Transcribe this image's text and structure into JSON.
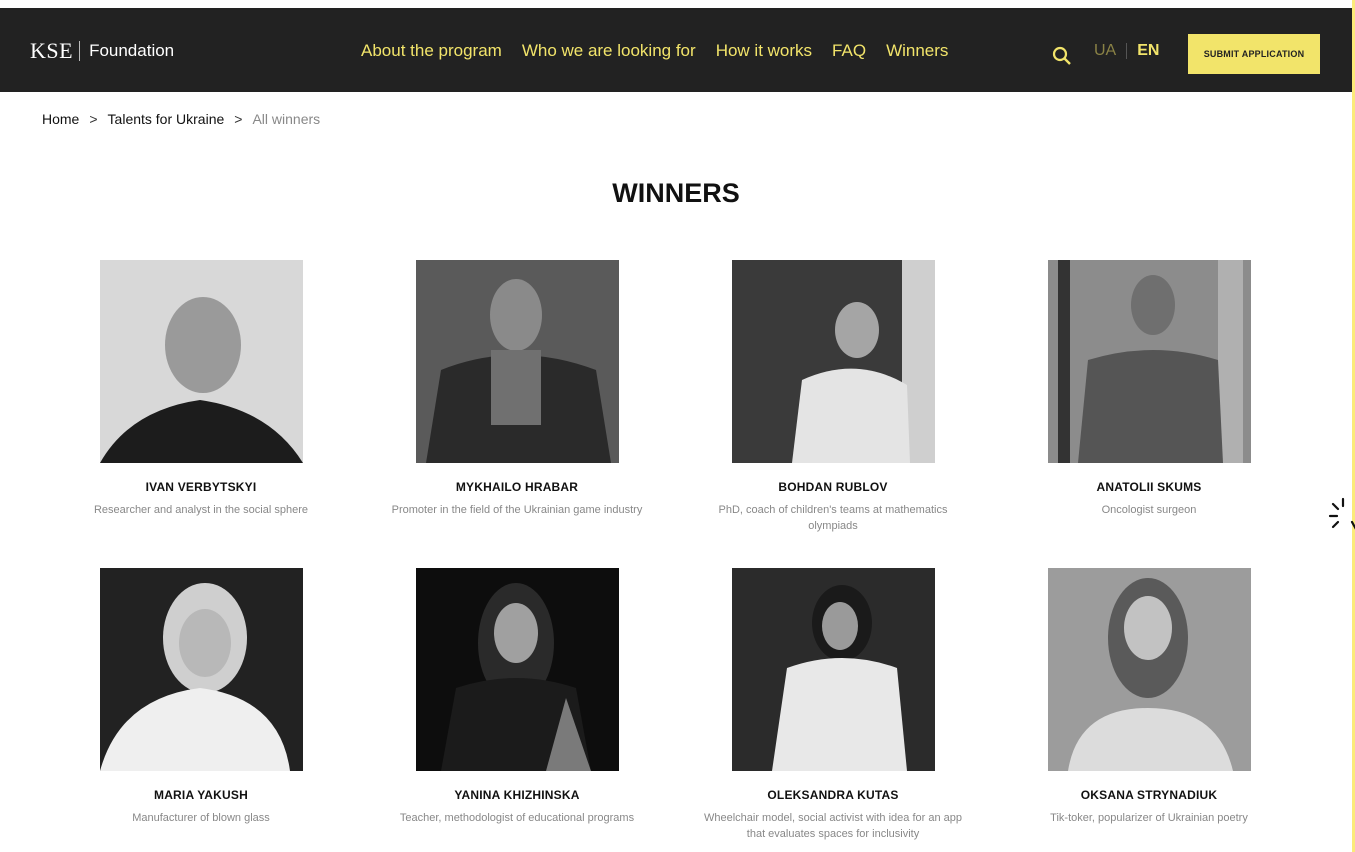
{
  "header": {
    "logo_mark": "KSE",
    "logo_text": "Foundation",
    "nav": [
      "About the program",
      "Who we are looking for",
      "How it works",
      "FAQ",
      "Winners"
    ],
    "lang_ua": "UA",
    "lang_en": "EN",
    "submit_label": "SUBMIT APPLICATION"
  },
  "breadcrumb": [
    "Home",
    "Talents for Ukraine",
    "All winners"
  ],
  "page_title": "WINNERS",
  "winners": [
    {
      "name": "IVAN VERBYTSKYI",
      "desc": "Researcher and analyst in the social sphere"
    },
    {
      "name": "MYKHAILO HRABAR",
      "desc": "Promoter in the field of the Ukrainian game industry"
    },
    {
      "name": "BOHDAN RUBLOV",
      "desc": "PhD, coach of children's teams at mathematics olympiads"
    },
    {
      "name": "ANATOLII SKUMS",
      "desc": "Oncologist surgeon"
    },
    {
      "name": "MARIA YAKUSH",
      "desc": "Manufacturer of blown glass"
    },
    {
      "name": "YANINA KHIZHINSKA",
      "desc": "Teacher, methodologist of educational programs"
    },
    {
      "name": "OLEKSANDRA KUTAS",
      "desc": "Wheelchair model, social activist with idea for an app that evaluates spaces for inclusivity"
    },
    {
      "name": "OKSANA STRYNADIUK",
      "desc": "Tik-toker, popularizer of Ukrainian poetry"
    }
  ],
  "colors": {
    "accent": "#f2e46a",
    "header_bg": "#222222",
    "frame": "#fbeb7a"
  }
}
